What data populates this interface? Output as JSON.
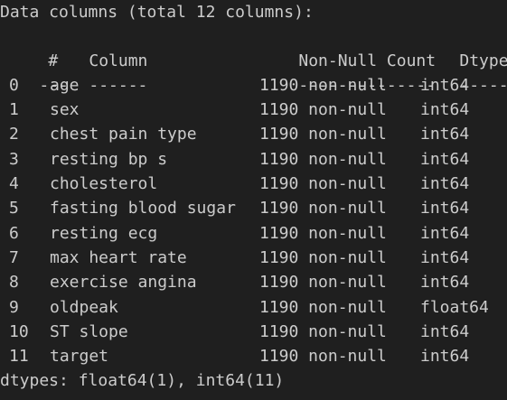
{
  "summary": "Data columns (total 12 columns):",
  "headers": {
    "index": "#",
    "column": "Column",
    "count": "Non-Null Count",
    "dtype": "Dtype"
  },
  "separators": {
    "index": "---",
    "column": "------",
    "count": "--------------",
    "dtype": "-----"
  },
  "rows": [
    {
      "index": "0",
      "column": "age",
      "count": "1190 non-null",
      "dtype": "int64"
    },
    {
      "index": "1",
      "column": "sex",
      "count": "1190 non-null",
      "dtype": "int64"
    },
    {
      "index": "2",
      "column": "chest pain type",
      "count": "1190 non-null",
      "dtype": "int64"
    },
    {
      "index": "3",
      "column": "resting bp s",
      "count": "1190 non-null",
      "dtype": "int64"
    },
    {
      "index": "4",
      "column": "cholesterol",
      "count": "1190 non-null",
      "dtype": "int64"
    },
    {
      "index": "5",
      "column": "fasting blood sugar",
      "count": "1190 non-null",
      "dtype": "int64"
    },
    {
      "index": "6",
      "column": "resting ecg",
      "count": "1190 non-null",
      "dtype": "int64"
    },
    {
      "index": "7",
      "column": "max heart rate",
      "count": "1190 non-null",
      "dtype": "int64"
    },
    {
      "index": "8",
      "column": "exercise angina",
      "count": "1190 non-null",
      "dtype": "int64"
    },
    {
      "index": "9",
      "column": "oldpeak",
      "count": "1190 non-null",
      "dtype": "float64"
    },
    {
      "index": "10",
      "column": "ST slope",
      "count": "1190 non-null",
      "dtype": "int64"
    },
    {
      "index": "11",
      "column": "target",
      "count": "1190 non-null",
      "dtype": "int64"
    }
  ],
  "footer": "dtypes: float64(1), int64(11)",
  "colors": {
    "background": "#1f1f1f",
    "text": "#cccccc"
  }
}
